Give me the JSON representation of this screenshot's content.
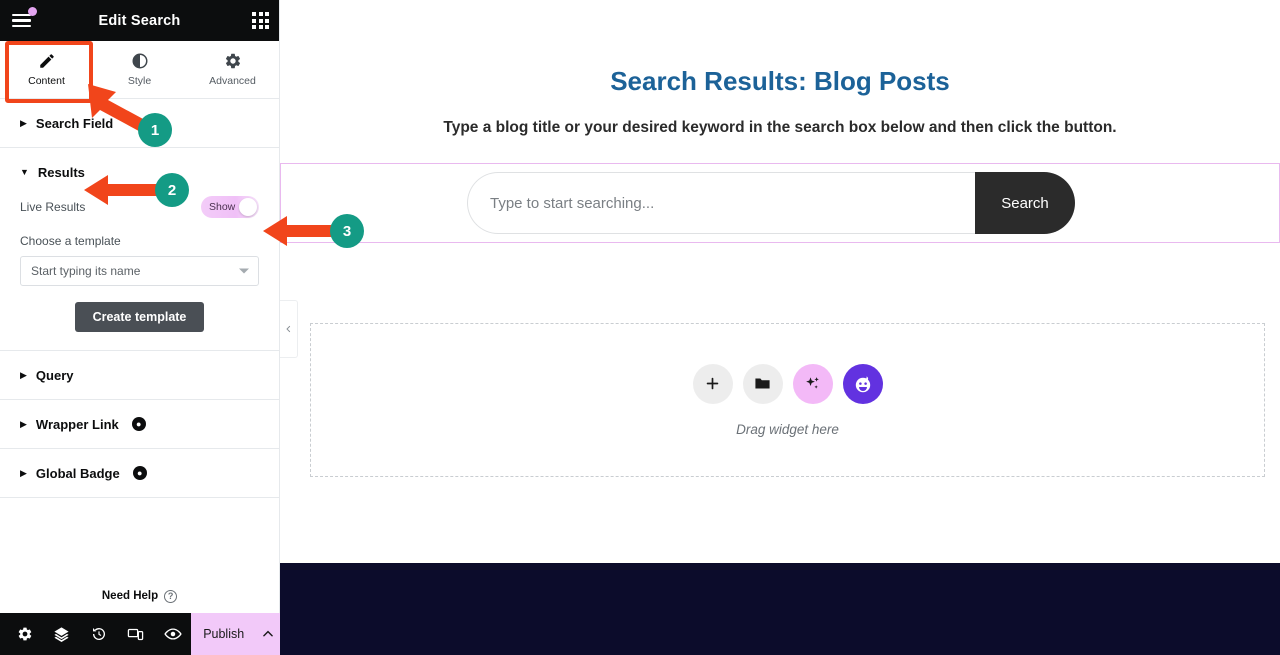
{
  "panel": {
    "title": "Edit Search",
    "menu_icon": "hamburger-icon",
    "widgets_icon": "grid-icon",
    "tabs": [
      {
        "label": "Content",
        "icon": "pencil-icon",
        "active": true
      },
      {
        "label": "Style",
        "icon": "contrast-icon",
        "active": false
      },
      {
        "label": "Advanced",
        "icon": "gear-icon",
        "active": false
      }
    ],
    "sections": [
      {
        "label": "Search Field",
        "expanded": false,
        "pro": false
      },
      {
        "label": "Results",
        "expanded": true,
        "pro": false
      },
      {
        "label": "Query",
        "expanded": false,
        "pro": false
      },
      {
        "label": "Wrapper Link",
        "expanded": false,
        "pro": true
      },
      {
        "label": "Global Badge",
        "expanded": false,
        "pro": true
      }
    ],
    "results": {
      "live_results_label": "Live Results",
      "live_results_toggle": "Show",
      "choose_template_label": "Choose a template",
      "template_select_value": "Start typing its name",
      "create_template_button": "Create template"
    },
    "need_help": "Need Help",
    "footer": {
      "icons": [
        "gear-icon",
        "layers-icon",
        "history-icon",
        "responsive-icon",
        "preview-icon"
      ],
      "publish_label": "Publish",
      "publish_arrow_icon": "chevron-up-icon"
    }
  },
  "canvas": {
    "page_title": "Search Results: Blog Posts",
    "page_subtitle": "Type a blog title or your desired keyword in the search box below and then click the button.",
    "search": {
      "placeholder": "Type to start searching...",
      "button_label": "Search"
    },
    "collapse_icon": "chevron-left-icon",
    "dropzone": {
      "caption": "Drag widget here",
      "buttons": [
        "plus-icon",
        "folder-icon",
        "ai-sparkle-icon",
        "assistant-face-icon"
      ]
    }
  },
  "annotations": {
    "steps": [
      {
        "number": "1",
        "target": "Content tab"
      },
      {
        "number": "2",
        "target": "Results section"
      },
      {
        "number": "3",
        "target": "Live Results toggle"
      }
    ],
    "highlight_color": "#f1451b",
    "badge_color": "#149b85"
  }
}
